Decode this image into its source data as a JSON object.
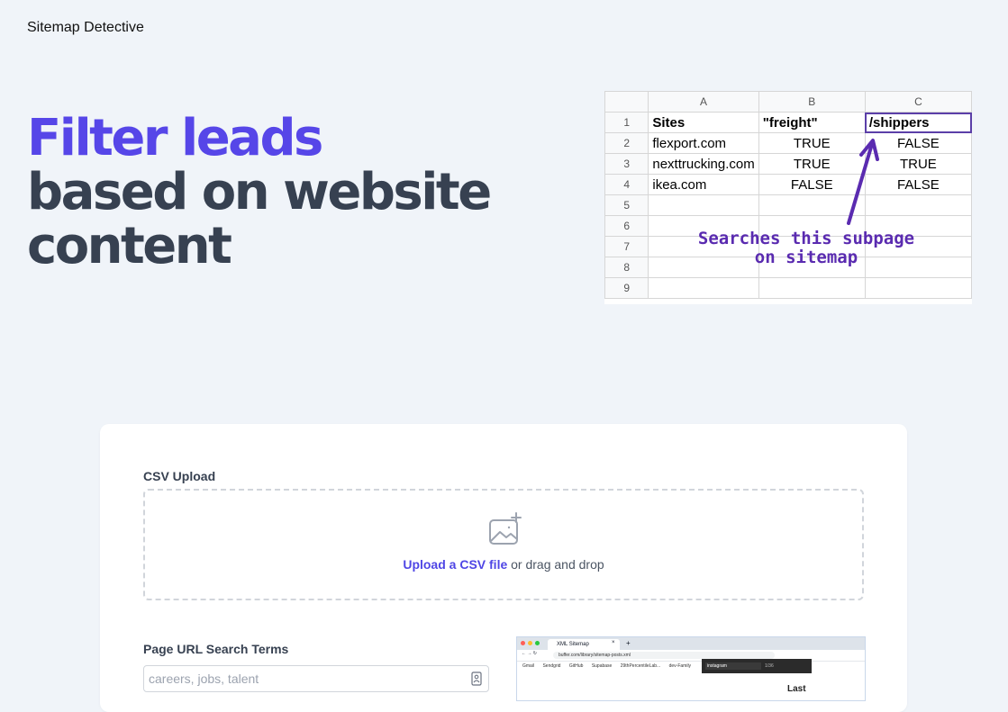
{
  "brand": "Sitemap Detective",
  "hero": {
    "line1": "Filter leads",
    "line2": "based on website",
    "line3": "content"
  },
  "sheet": {
    "columns": [
      "A",
      "B",
      "C"
    ],
    "rows": [
      {
        "n": "1",
        "a": "Sites",
        "b": "\"freight\"",
        "c": "/shippers"
      },
      {
        "n": "2",
        "a": "flexport.com",
        "b": "TRUE",
        "c": "FALSE"
      },
      {
        "n": "3",
        "a": "nexttrucking.com",
        "b": "TRUE",
        "c": "TRUE"
      },
      {
        "n": "4",
        "a": "ikea.com",
        "b": "FALSE",
        "c": "FALSE"
      },
      {
        "n": "5",
        "a": "",
        "b": "",
        "c": ""
      },
      {
        "n": "6",
        "a": "",
        "b": "",
        "c": ""
      },
      {
        "n": "7",
        "a": "",
        "b": "",
        "c": ""
      },
      {
        "n": "8",
        "a": "",
        "b": "",
        "c": ""
      },
      {
        "n": "9",
        "a": "",
        "b": "",
        "c": ""
      }
    ],
    "annotation_line1": "Searches this subpage",
    "annotation_line2": "on sitemap",
    "arrow_color": "#5a2bb0"
  },
  "upload": {
    "label": "CSV Upload",
    "link_text": "Upload a CSV file",
    "rest_text": " or drag and drop",
    "icon": "image-plus-icon"
  },
  "search_terms": {
    "label": "Page URL Search Terms",
    "placeholder": "careers, jobs, talent",
    "icon": "contact-card-icon"
  },
  "thumbnail": {
    "tab_title": "XML Sitemap",
    "url": "buffer.com/library/sitemap-posts.xml",
    "bookmarks": [
      "Gmail",
      "Sendgrid",
      "GitHub",
      "Supabase",
      "29thPercentileLab...",
      "dev-Family"
    ],
    "find_query": "instagram",
    "find_count": "1/36",
    "content_word": "Last"
  },
  "colors": {
    "accent": "#5646e8",
    "hero_dark": "#374151",
    "background": "#f0f4f9",
    "link": "#4f46e5"
  }
}
